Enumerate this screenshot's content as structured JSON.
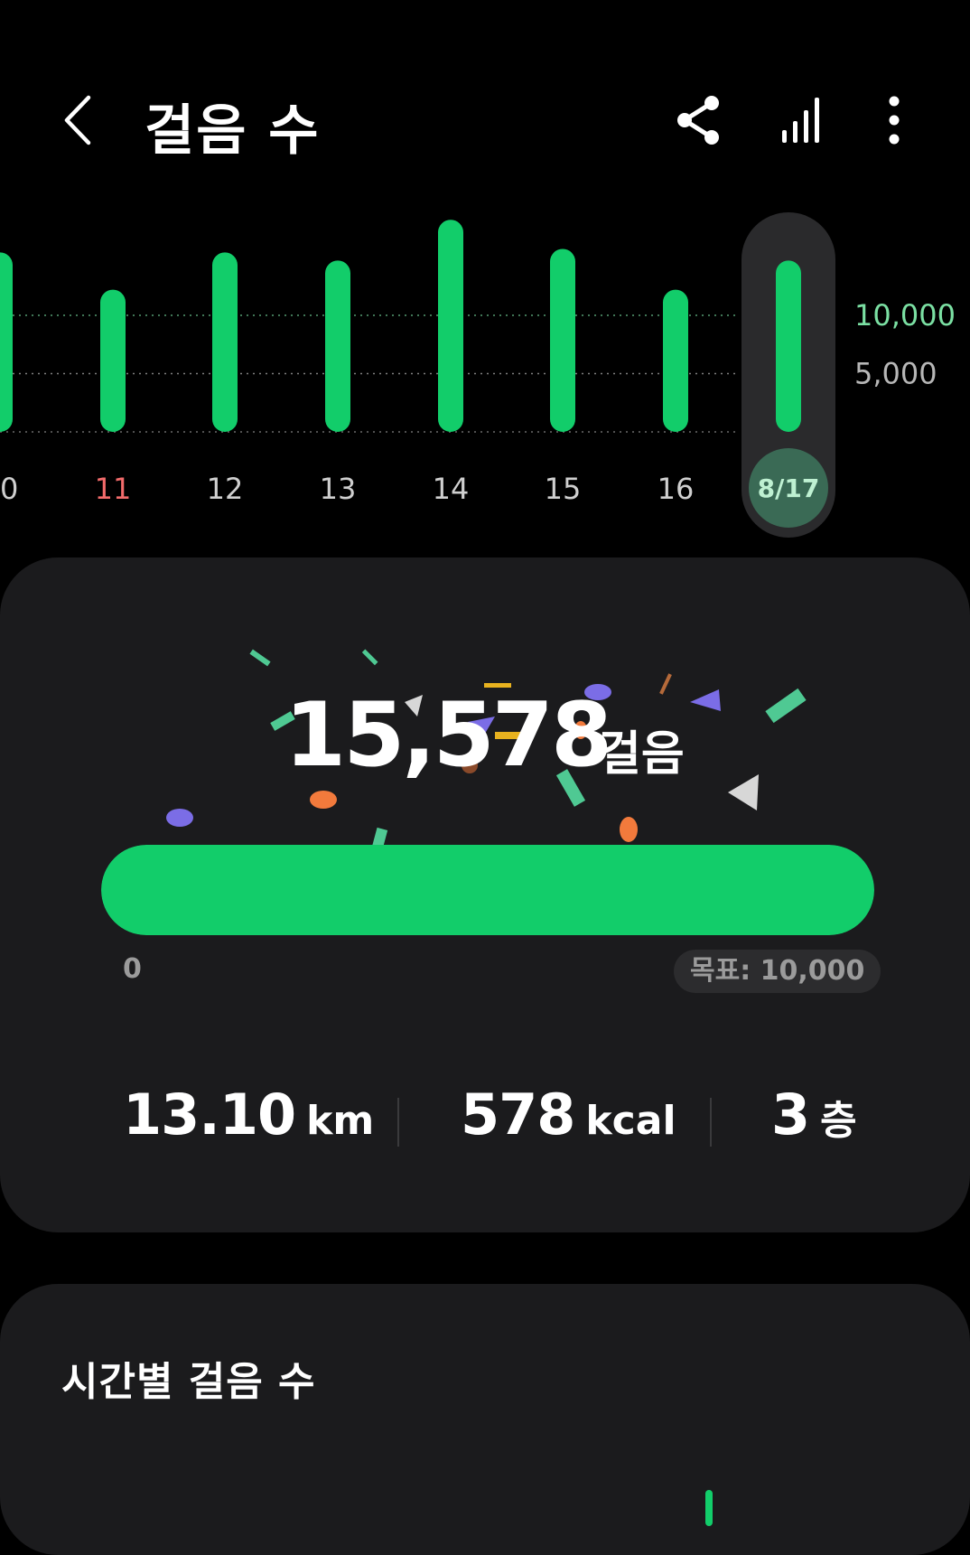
{
  "header": {
    "title": "걸음 수",
    "icons": [
      "chevron-left-icon",
      "share-icon",
      "bar-chart-icon",
      "more-vert-icon"
    ]
  },
  "chart_data": {
    "type": "bar",
    "categories": [
      "0",
      "11",
      "12",
      "13",
      "14",
      "15",
      "16",
      "8/17"
    ],
    "values": [
      15400,
      12200,
      15400,
      14700,
      18200,
      15700,
      12200,
      14700
    ],
    "selected": "8/17",
    "y_reference_lines": [
      {
        "value": 10000,
        "label": "10,000",
        "color": "#7be0a3"
      },
      {
        "value": 5000,
        "label": "5,000",
        "color": "#b7b7b7"
      }
    ],
    "highlight_categories": {
      "11": "#f26b6b"
    },
    "bar_color": "#12cd6a"
  },
  "summary": {
    "steps": "15,578",
    "steps_unit": "걸음",
    "progress_fraction": 1.0,
    "range_min": "0",
    "goal_label": "목표: 10,000"
  },
  "stats": {
    "distance": {
      "value": "13.10",
      "unit": "km"
    },
    "calories": {
      "value": "578",
      "unit": "kcal"
    },
    "floors": {
      "value": "3",
      "unit": "층"
    }
  },
  "hourly": {
    "title": "시간별 걸음 수"
  },
  "colors": {
    "accent": "#12cd6a",
    "background": "#000000",
    "card": "#1b1b1d",
    "selected_pill": "#2a2a2c",
    "selected_circle": "#3a6a55"
  }
}
